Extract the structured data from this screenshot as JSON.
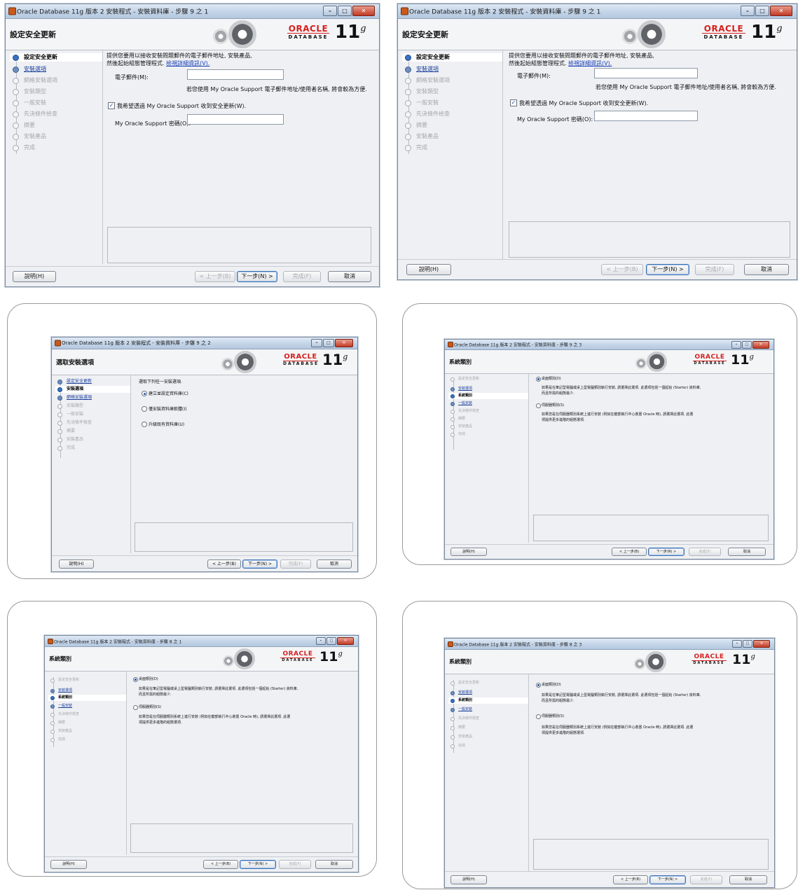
{
  "window_title_9_1": "Oracle Database 11g 版本 2 安裝程式 - 安裝資料庫 - 步驟 9 之 1",
  "window_title_9_2": "Oracle Database 11g 版本 2 安裝程式 - 安裝資料庫 - 步驟 9 之 2",
  "window_title_9_3": "Oracle Database 11g 版本 2 安裝程式 - 安裝資料庫 - 步驟 9 之 3",
  "window_title_8_1": "Oracle Database 11g 版本 2 安裝程式 - 安裝資料庫 - 步驟 8 之 1",
  "window_title_8_3": "Oracle Database 11g 版本 2 安裝程式 - 安裝資料庫 - 步驟 8 之 3",
  "logo": {
    "oracle": "ORACLE",
    "database": "DATABASE",
    "version": "11",
    "version_sup": "g"
  },
  "buttons": {
    "help": "說明(H)",
    "back": "< 上一步(B)",
    "next": "下一步(N) >",
    "finish": "完成(F)",
    "cancel": "取消"
  },
  "steps": {
    "security": "設定安全更新",
    "install_options": "安裝選項",
    "system_class": "系統類別",
    "grid_options": "網格安裝選項",
    "install_type": "安裝類型",
    "typical_install": "一般安裝",
    "prereq_check": "先決條件檢查",
    "summary": "摘要",
    "install_product": "安裝產品",
    "finish": "完成"
  },
  "panel1": {
    "header": "設定安全更新",
    "intro1": "提供您要用以接收安裝問題郵件的電子郵件地址, 安裝產品,",
    "intro2": "然後起始組態管理程式.",
    "intro_link": "檢視詳細資訊(V).",
    "email_label": "電子郵件(M):",
    "email_value": "",
    "email_hint": "若您使用 My Oracle Support 電子郵件地址/使用者名稱, 將會較為方便.",
    "checkbox_label": "我希望透過 My Oracle Support 收到安全更新(W).",
    "checkbox_checked": true,
    "password_label": "My Oracle Support 密碼(O):",
    "password_value": ""
  },
  "panel2": {
    "header": "選取安裝選項",
    "prompt": "選取下列任一安裝選項.",
    "opt1": "建立並設定資料庫(C)",
    "opt2": "僅安裝資料庫軟體(I)",
    "opt3": "升級既有資料庫(U)",
    "selected": 1
  },
  "panel3": {
    "header": "系統類別",
    "opt1": "桌面類別(D)",
    "opt1_desc1": "如果是在筆記型電腦或桌上型電腦類別執行安裝, 請選擇此選項. 此選項包括一個起始 (Starter) 資料庫,",
    "opt1_desc2": "而且所需的組態最少.",
    "opt2": "伺服器類別(S)",
    "opt2_desc1": "如果您是在伺服器類別系統上進行安裝 (例如在鍵部執行中心裝置 Oracle 時), 請選擇此選項. 此選",
    "opt2_desc2": "項提供更多進階的組態選項.",
    "selected": 1
  }
}
